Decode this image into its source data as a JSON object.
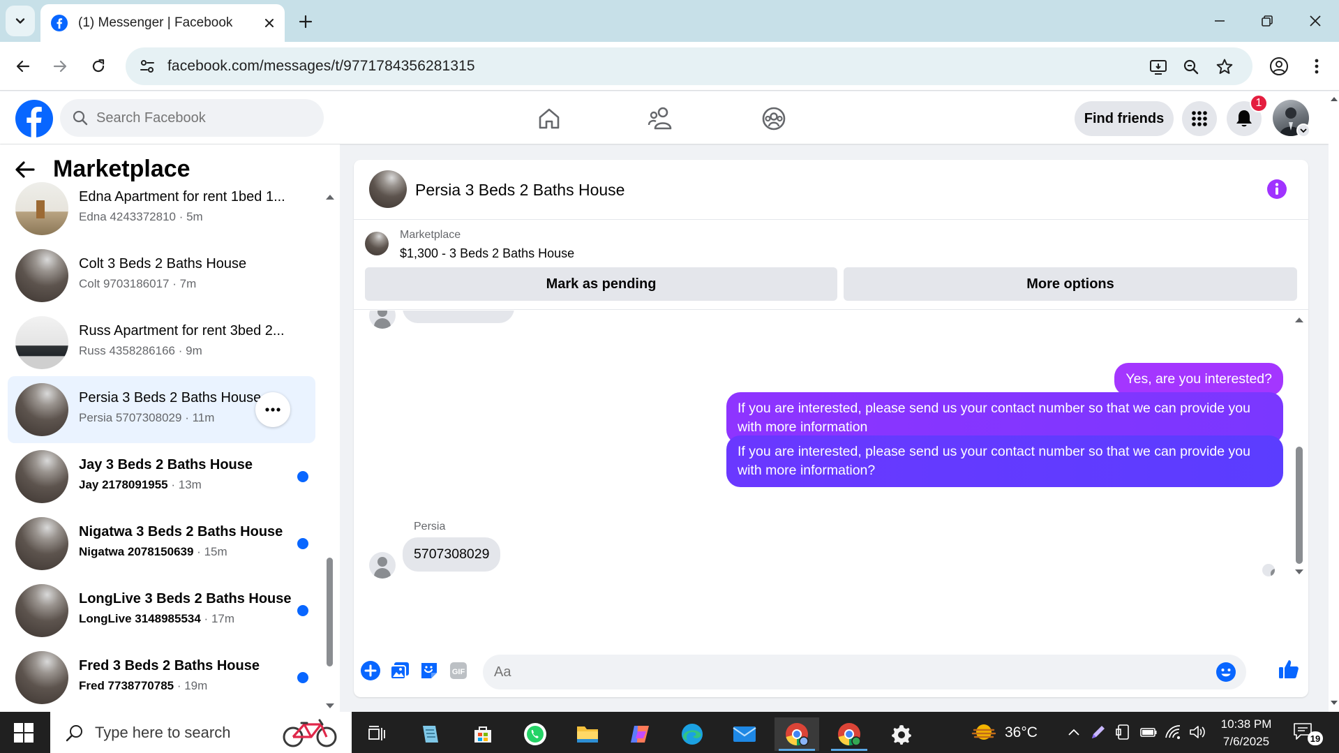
{
  "browser": {
    "tab_title": "(1) Messenger | Facebook",
    "url": "facebook.com/messages/t/9771784356281315"
  },
  "fb_header": {
    "search_placeholder": "Search Facebook",
    "find_friends_label": "Find friends",
    "notification_count": "1"
  },
  "sidebar": {
    "title": "Marketplace",
    "conversations": [
      {
        "name": "Edna Apartment for rent 1bed 1...",
        "who": "Edna 4243372810",
        "time": "5m",
        "unread": false,
        "active": false,
        "thumb": "room"
      },
      {
        "name": "Colt 3 Beds 2 Baths House",
        "who": "Colt 9703186017",
        "time": "7m",
        "unread": false,
        "active": false,
        "thumb": "floor"
      },
      {
        "name": "Russ Apartment for rent 3bed 2...",
        "who": "Russ 4358286166",
        "time": "9m",
        "unread": false,
        "active": false,
        "thumb": "table"
      },
      {
        "name": "Persia 3 Beds 2 Baths House",
        "who": "Persia 5707308029",
        "time": "11m",
        "unread": false,
        "active": true,
        "thumb": "floor"
      },
      {
        "name": "Jay 3 Beds 2 Baths House",
        "who": "Jay 2178091955",
        "time": "13m",
        "unread": true,
        "active": false,
        "thumb": "floor"
      },
      {
        "name": "Nigatwa 3 Beds 2 Baths House",
        "who": "Nigatwa 2078150639",
        "time": "15m",
        "unread": true,
        "active": false,
        "thumb": "floor"
      },
      {
        "name": "LongLive 3 Beds 2 Baths House",
        "who": "LongLive 3148985534",
        "time": "17m",
        "unread": true,
        "active": false,
        "thumb": "floor"
      },
      {
        "name": "Fred 3 Beds 2 Baths House",
        "who": "Fred 7738770785",
        "time": "19m",
        "unread": true,
        "active": false,
        "thumb": "floor"
      }
    ]
  },
  "chat": {
    "title": "Persia 3 Beds 2 Baths House",
    "listing": {
      "label": "Marketplace",
      "description": "$1,300 - 3 Beds 2 Baths House",
      "mark_pending_label": "Mark as pending",
      "more_options_label": "More options"
    },
    "messages": {
      "outgoing": [
        "Yes, are you interested?",
        "If you are interested, please send us your contact number so that we can provide you with more information",
        "If you are interested, please send us your contact number so that we can provide you with more information?"
      ],
      "sender_name": "Persia",
      "incoming": "5707308029"
    },
    "composer_placeholder": "Aa"
  },
  "taskbar": {
    "search_placeholder": "Type here to search",
    "temperature": "36°C",
    "time": "10:38 PM",
    "date": "7/6/2025",
    "notification_count": "19"
  },
  "colors": {
    "fb_blue": "#0866ff",
    "bubble_start": "#a033ff",
    "bubble_end": "#5b3dff",
    "unread_dot": "#0866ff"
  }
}
